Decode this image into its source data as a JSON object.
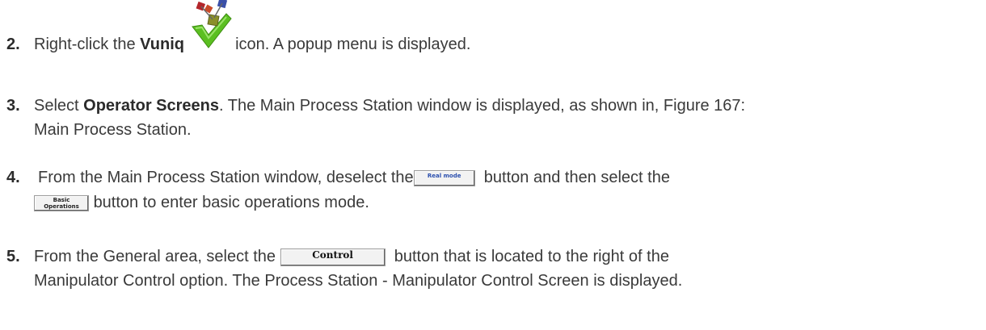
{
  "steps": [
    {
      "num": "2.",
      "before": "Right-click the ",
      "bold": "Vuniq",
      "after": " icon. A popup menu is displayed.",
      "icon": "vuniq-checkmark-icon"
    },
    {
      "num": "3.",
      "before": "Select ",
      "bold": "Operator Screens",
      "line1_after": ". The Main Process Station window is displayed, as shown in, Figure 167:",
      "line2": "Main Process Station."
    },
    {
      "num": "4.",
      "line1_before": "From the Main Process Station window, deselect the",
      "button1_label": "Real mode",
      "line1_after": "button and then select the",
      "button2_label_line1": "Basic",
      "button2_label_line2": "Operations",
      "line2_after": "button to enter basic operations mode."
    },
    {
      "num": "5.",
      "line1_before": "From the General area, select the",
      "button_label": "Control",
      "line1_after": "button that is located to the right of the",
      "line2": "Manipulator Control option. The Process Station - Manipulator Control Screen is displayed."
    }
  ],
  "colors": {
    "text": "#3a3a3a",
    "icon_green": "#5bbf21",
    "icon_red": "#b3262b",
    "icon_blue": "#3a4fa8",
    "icon_olive": "#8a8f2a"
  }
}
